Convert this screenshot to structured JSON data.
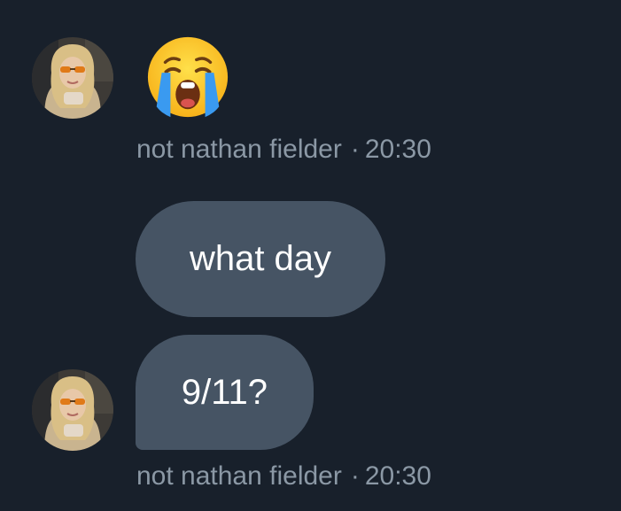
{
  "conversation": {
    "messages": [
      {
        "emoji": "loudly-crying-face",
        "sender": "not nathan fielder",
        "separator": "·",
        "time": "20:30"
      },
      {
        "text": "what day",
        "variant": "grouped"
      },
      {
        "text": "9/11?",
        "sender": "not nathan fielder",
        "separator": "·",
        "time": "20:30"
      }
    ]
  },
  "colors": {
    "background": "#18202b",
    "bubble": "#465464",
    "meta_text": "#8b98a5",
    "message_text": "#ffffff"
  },
  "icons": {
    "avatar": "profile-photo-blonde-woman-orange-sunglasses"
  }
}
